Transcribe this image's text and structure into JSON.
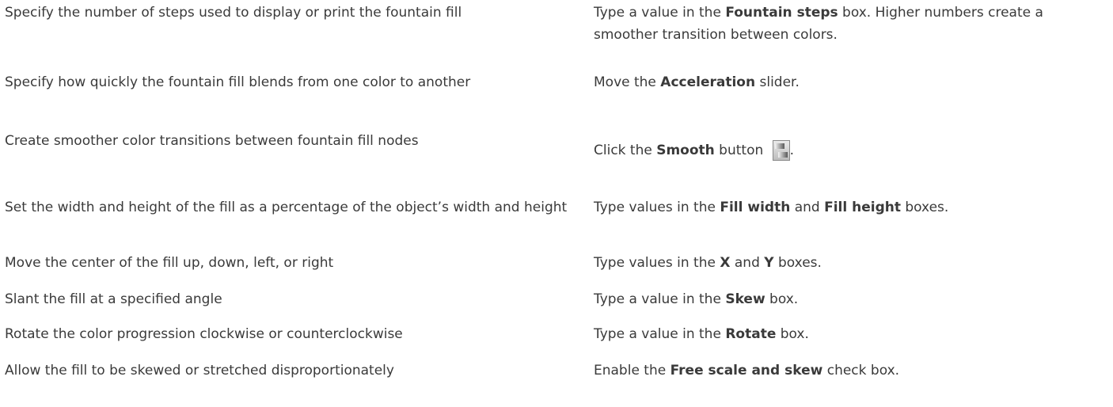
{
  "rows": [
    {
      "task": "Specify the number of steps used to display or print the fountain fill",
      "action_pre": "Type a value in the ",
      "action_ui": "Fountain steps",
      "action_post": " box. Higher numbers create a smoother transition between colors."
    },
    {
      "task": "Specify how quickly the fountain fill blends from one color to another",
      "action_pre": "Move the ",
      "action_ui": "Acceleration",
      "action_post": " slider."
    },
    {
      "task": "Create smoother color transitions between fountain fill nodes",
      "action_pre": "Click the ",
      "action_ui": "Smooth",
      "action_post": " button ",
      "action_end": ".",
      "icon": "smooth-button-icon"
    },
    {
      "task": "Set the width and height of the fill as a percentage of the object’s width and height",
      "action_pre": "Type values in the ",
      "action_ui": "Fill width",
      "action_mid": " and ",
      "action_ui2": "Fill height",
      "action_post": " boxes."
    },
    {
      "task": "Move the center of the fill up, down, left, or right",
      "action_pre": "Type values in the ",
      "action_ui": "X",
      "action_mid": " and ",
      "action_ui2": "Y",
      "action_post": " boxes."
    },
    {
      "task": "Slant the fill at a specified angle",
      "action_pre": "Type a value in the ",
      "action_ui": "Skew",
      "action_post": " box."
    },
    {
      "task": "Rotate the color progression clockwise or counterclockwise",
      "action_pre": "Type a value in the ",
      "action_ui": "Rotate",
      "action_post": " box."
    },
    {
      "task": "Allow the fill to be skewed or stretched disproportionately",
      "action_pre": "Enable the ",
      "action_ui": "Free scale and skew",
      "action_post": " check box."
    }
  ]
}
